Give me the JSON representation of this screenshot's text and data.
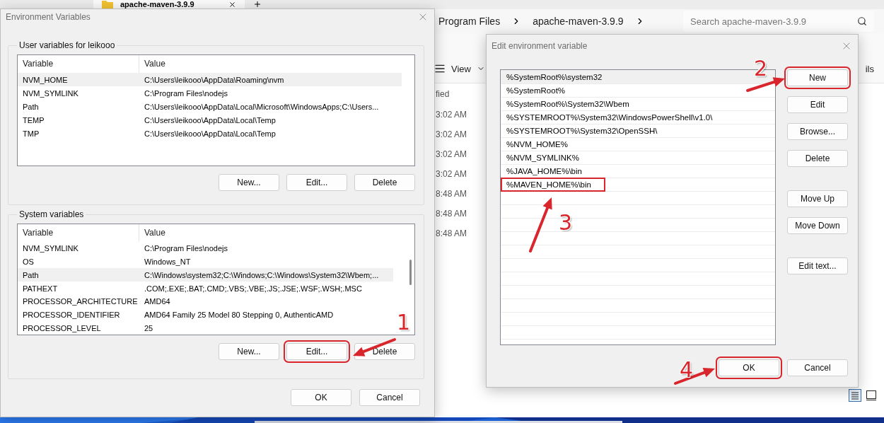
{
  "explorer": {
    "tab": {
      "label": "apache-maven-3.9.9",
      "selected": true
    },
    "breadcrumb": [
      "Program Files",
      "apache-maven-3.9.9"
    ],
    "search": {
      "placeholder": "Search apache-maven-3.9.9"
    },
    "toolbar": {
      "view": "View",
      "details": "ils"
    },
    "column": "fied",
    "times": [
      "3:02 AM",
      "3:02 AM",
      "3:02 AM",
      "3:02 AM",
      "8:48 AM",
      "8:48 AM",
      "8:48 AM"
    ]
  },
  "env_dialog": {
    "title": "Environment Variables",
    "groups": [
      {
        "title": "User variables for leikooo",
        "columns": [
          "Variable",
          "Value"
        ],
        "scrollbar": false,
        "rows": [
          {
            "variable": "NVM_HOME",
            "value": "C:\\Users\\leikooo\\AppData\\Roaming\\nvm",
            "selected": true
          },
          {
            "variable": "NVM_SYMLINK",
            "value": "C:\\Program Files\\nodejs",
            "selected": false
          },
          {
            "variable": "Path",
            "value": "C:\\Users\\leikooo\\AppData\\Local\\Microsoft\\WindowsApps;C:\\Users...",
            "selected": false
          },
          {
            "variable": "TEMP",
            "value": "C:\\Users\\leikooo\\AppData\\Local\\Temp",
            "selected": false
          },
          {
            "variable": "TMP",
            "value": "C:\\Users\\leikooo\\AppData\\Local\\Temp",
            "selected": false
          }
        ],
        "buttons": [
          {
            "label": "New...",
            "highlighted": false
          },
          {
            "label": "Edit...",
            "highlighted": false
          },
          {
            "label": "Delete",
            "highlighted": false
          }
        ]
      },
      {
        "title": "System variables",
        "columns": [
          "Variable",
          "Value"
        ],
        "scrollbar": true,
        "rows": [
          {
            "variable": "NVM_SYMLINK",
            "value": "C:\\Program Files\\nodejs",
            "selected": false
          },
          {
            "variable": "OS",
            "value": "Windows_NT",
            "selected": false
          },
          {
            "variable": "Path",
            "value": "C:\\Windows\\system32;C:\\Windows;C:\\Windows\\System32\\Wbem;...",
            "selected": true
          },
          {
            "variable": "PATHEXT",
            "value": ".COM;.EXE;.BAT;.CMD;.VBS;.VBE;.JS;.JSE;.WSF;.WSH;.MSC",
            "selected": false
          },
          {
            "variable": "PROCESSOR_ARCHITECTURE",
            "value": "AMD64",
            "selected": false
          },
          {
            "variable": "PROCESSOR_IDENTIFIER",
            "value": "AMD64 Family 25 Model 80 Stepping 0, AuthenticAMD",
            "selected": false
          },
          {
            "variable": "PROCESSOR_LEVEL",
            "value": "25",
            "selected": false
          }
        ],
        "buttons": [
          {
            "label": "New...",
            "highlighted": false
          },
          {
            "label": "Edit...",
            "highlighted": true
          },
          {
            "label": "Delete",
            "highlighted": false
          }
        ]
      }
    ],
    "buttons": [
      {
        "label": "OK",
        "highlighted": false
      },
      {
        "label": "Cancel",
        "highlighted": false
      }
    ]
  },
  "edit_dialog": {
    "title": "Edit environment variable",
    "entries": [
      {
        "text": "%SystemRoot%\\system32",
        "selected": true,
        "highlighted": false
      },
      {
        "text": "%SystemRoot%",
        "selected": false,
        "highlighted": false
      },
      {
        "text": "%SystemRoot%\\System32\\Wbem",
        "selected": false,
        "highlighted": false
      },
      {
        "text": "%SYSTEMROOT%\\System32\\WindowsPowerShell\\v1.0\\",
        "selected": false,
        "highlighted": false
      },
      {
        "text": "%SYSTEMROOT%\\System32\\OpenSSH\\",
        "selected": false,
        "highlighted": false
      },
      {
        "text": "%NVM_HOME%",
        "selected": false,
        "highlighted": false
      },
      {
        "text": "%NVM_SYMLINK%",
        "selected": false,
        "highlighted": false
      },
      {
        "text": "%JAVA_HOME%\\bin",
        "selected": false,
        "highlighted": false
      },
      {
        "text": "%MAVEN_HOME%\\bin",
        "selected": false,
        "highlighted": true
      }
    ],
    "button_groups": [
      [
        {
          "label": "New",
          "highlighted": true
        },
        {
          "label": "Edit",
          "highlighted": false
        },
        {
          "label": "Browse...",
          "highlighted": false
        },
        {
          "label": "Delete",
          "highlighted": false
        }
      ],
      [
        {
          "label": "Move Up",
          "highlighted": false
        },
        {
          "label": "Move Down",
          "highlighted": false
        }
      ],
      [
        {
          "label": "Edit text...",
          "highlighted": false
        }
      ]
    ],
    "buttons": [
      {
        "label": "OK",
        "highlighted": true
      },
      {
        "label": "Cancel",
        "highlighted": false
      }
    ]
  },
  "annotations": [
    {
      "label": "1"
    },
    {
      "label": "2"
    },
    {
      "label": "3"
    },
    {
      "label": "4"
    }
  ]
}
